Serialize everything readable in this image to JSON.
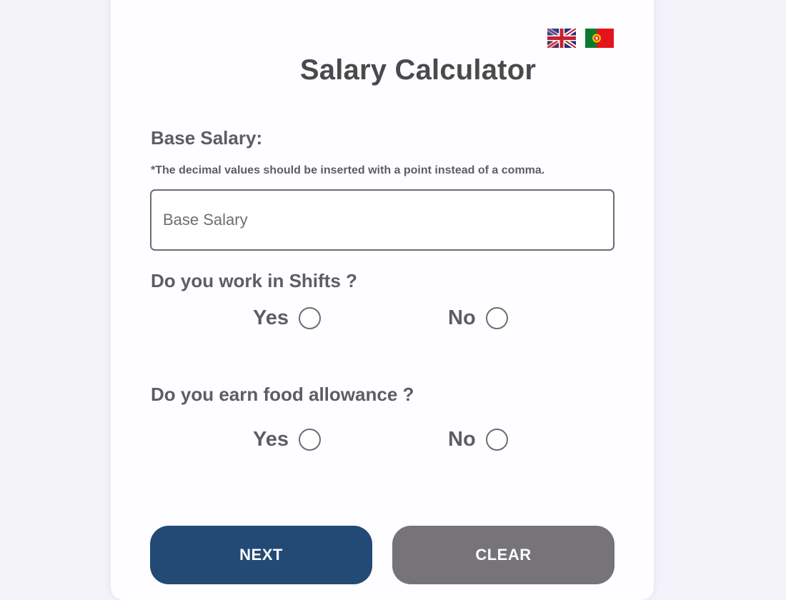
{
  "colors": {
    "page_background": "#f4f2fb",
    "card_background": "#fefdff",
    "text": "#5f5d62",
    "next_button": "#234a74",
    "clear_button": "#767478"
  },
  "languages": [
    {
      "name": "English",
      "icon": "uk-flag-icon"
    },
    {
      "name": "Portuguese",
      "icon": "portugal-flag-icon"
    }
  ],
  "title": "Salary Calculator",
  "base_salary": {
    "label": "Base Salary:",
    "note": "*The decimal values should be inserted with a point instead of a comma.",
    "placeholder": "Base Salary",
    "value": ""
  },
  "shifts": {
    "question": "Do you work in Shifts ?",
    "yes_label": "Yes",
    "no_label": "No",
    "selected": null
  },
  "food_allowance": {
    "question": "Do you earn food allowance ?",
    "yes_label": "Yes",
    "no_label": "No",
    "selected": null
  },
  "buttons": {
    "next_label": "NEXT",
    "clear_label": "CLEAR"
  }
}
